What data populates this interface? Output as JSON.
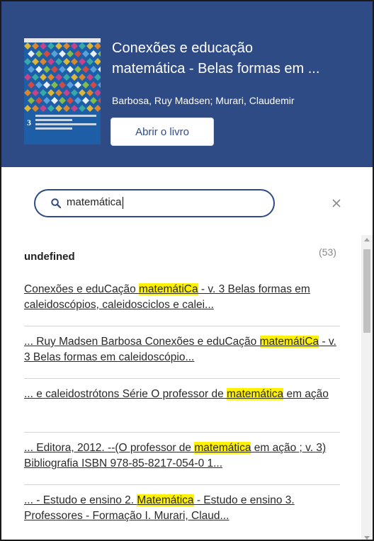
{
  "book": {
    "title_line1": "Conexões e educação",
    "title_line2": "matemática - Belas formas em ...",
    "authors": "Barbosa, Ruy Madsen; Murari, Claudemir",
    "open_button": "Abrir o livro",
    "cover_number": "3",
    "cover_icon": "book-cover-image"
  },
  "search": {
    "value": "matemática",
    "search_icon": "search-icon",
    "clear_icon": "close-icon"
  },
  "results": {
    "group_label": "undefined",
    "group_count": "(53)",
    "items": [
      {
        "before": "Conexões e eduCação ",
        "highlight": "matemátiCa",
        "after": " - v. 3 Belas formas em caleidoscópios, caleidosciclos e calei..."
      },
      {
        "before": "... Ruy Madsen Barbosa Conexões e eduCação ",
        "highlight": "matemátiCa",
        "after": " - v. 3 Belas formas em caleidoscópio..."
      },
      {
        "before": "... e caleidostrótons Série O professor de ",
        "highlight": "matemática",
        "after": " em ação"
      },
      {
        "before": "... Editora, 2012. --(O professor de ",
        "highlight": "matemática",
        "after": " em ação ; v. 3) Bibliografia ISBN 978-85-8217-054-0 1..."
      },
      {
        "before": "... - Estudo e ensino 2. ",
        "highlight": "Matemática",
        "after": " - Estudo e ensino 3. Professores - Formação I. Murari, Claud..."
      }
    ]
  },
  "colors": {
    "header_bg": "#2e4b86",
    "highlight": "#fff200",
    "accent": "#2e4b86"
  }
}
